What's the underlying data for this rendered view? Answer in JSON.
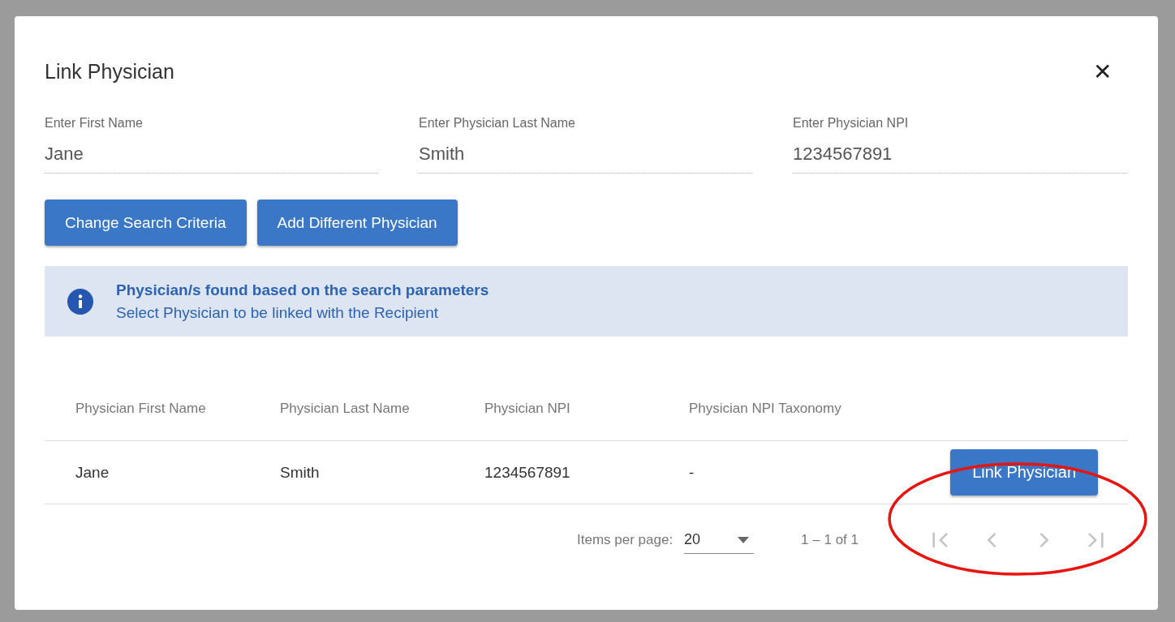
{
  "dialog": {
    "title": "Link Physician",
    "close": "✕"
  },
  "fields": [
    {
      "label": "Enter First Name",
      "value": "Jane"
    },
    {
      "label": "Enter Physician Last Name",
      "value": "Smith"
    },
    {
      "label": "Enter Physician NPI",
      "value": "1234567891"
    }
  ],
  "buttons": [
    "Change Search Criteria",
    "Add Different Physician"
  ],
  "banner": {
    "title": "Physician/s found based on the search parameters",
    "message": "Select Physician to be linked with the Recipient"
  },
  "table": {
    "columns": [
      "Physician First Name",
      "Physician Last Name",
      "Physician NPI",
      "Physician NPI Taxonomy"
    ],
    "rows": [
      {
        "cells": [
          "Jane",
          "Smith",
          "1234567891",
          "-"
        ],
        "action": "Link Physician"
      }
    ]
  },
  "paginator": {
    "label": "Items per page:",
    "page_size": "20",
    "range": "1 – 1 of 1",
    "nav": [
      {
        "kind": "first",
        "disabled": true
      },
      {
        "kind": "prev",
        "disabled": true
      },
      {
        "kind": "next",
        "disabled": true
      },
      {
        "kind": "last",
        "disabled": true
      }
    ]
  },
  "annotation": {
    "kind": "ellipse",
    "color": "#e8140f"
  }
}
